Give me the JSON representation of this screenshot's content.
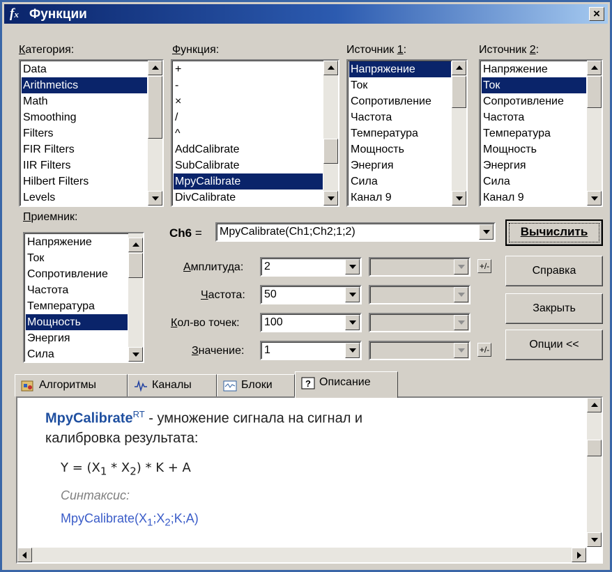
{
  "window": {
    "title": "Функции",
    "close": "×"
  },
  "category": {
    "label_u": "К",
    "label_rest": "атегория:",
    "items": [
      {
        "text": "Data"
      },
      {
        "text": "Arithmetics",
        "selected": true
      },
      {
        "text": "Math"
      },
      {
        "text": "Smoothing"
      },
      {
        "text": "Filters"
      },
      {
        "text": "FIR Filters"
      },
      {
        "text": "IIR Filters"
      },
      {
        "text": "Hilbert Filters"
      },
      {
        "text": "Levels"
      }
    ]
  },
  "function": {
    "label_u": "Ф",
    "label_rest": "ункция:",
    "items": [
      {
        "text": "+"
      },
      {
        "text": "-"
      },
      {
        "text": "×"
      },
      {
        "text": "/"
      },
      {
        "text": "^"
      },
      {
        "text": "AddCalibrate"
      },
      {
        "text": "SubCalibrate"
      },
      {
        "text": "MpyCalibrate",
        "selected": true
      },
      {
        "text": "DivCalibrate"
      }
    ]
  },
  "source1": {
    "label_pre": "Источник ",
    "label_u": "1",
    "label_post": ":",
    "items": [
      {
        "text": "Напряжение",
        "selected": true
      },
      {
        "text": "Ток"
      },
      {
        "text": "Сопротивление"
      },
      {
        "text": "Частота"
      },
      {
        "text": "Температура"
      },
      {
        "text": "Мощность"
      },
      {
        "text": "Энергия"
      },
      {
        "text": "Сила"
      },
      {
        "text": "Канал 9"
      }
    ]
  },
  "source2": {
    "label_pre": "Источник ",
    "label_u": "2",
    "label_post": ":",
    "items": [
      {
        "text": "Напряжение"
      },
      {
        "text": "Ток",
        "selected": true
      },
      {
        "text": "Сопротивление"
      },
      {
        "text": "Частота"
      },
      {
        "text": "Температура"
      },
      {
        "text": "Мощность"
      },
      {
        "text": "Энергия"
      },
      {
        "text": "Сила"
      },
      {
        "text": "Канал 9"
      }
    ]
  },
  "receiver": {
    "label_u": "П",
    "label_rest": "риемник:",
    "items": [
      {
        "text": "Напряжение"
      },
      {
        "text": "Ток"
      },
      {
        "text": "Сопротивление"
      },
      {
        "text": "Частота"
      },
      {
        "text": "Температура"
      },
      {
        "text": "Мощность",
        "selected": true
      },
      {
        "text": "Энергия"
      },
      {
        "text": "Сила"
      }
    ]
  },
  "formula": {
    "channel": "Ch6",
    "eq": "=",
    "value": "MpyCalibrate(Ch1;Ch2;1;2)"
  },
  "params": {
    "amplitude": {
      "label_u": "А",
      "label_rest": "мплитуда:",
      "value": "2"
    },
    "frequency": {
      "label_u": "Ч",
      "label_rest": "астота:",
      "value": "50"
    },
    "points": {
      "label_u": "К",
      "label_rest": "ол-во точек:",
      "value": "100"
    },
    "value": {
      "label_u": "З",
      "label_rest": "начение:",
      "value": "1"
    }
  },
  "buttons": {
    "compute": "Вычислить",
    "help": "Справка",
    "close": "Закрыть",
    "options": "Опции <<"
  },
  "tabs": {
    "algorithms": "Алгоритмы",
    "channels": "Каналы",
    "blocks": "Блоки",
    "description": "Описание"
  },
  "description": {
    "name": "MpyCalibrate",
    "sup": "RT",
    "text1": " - умножение сигнала на сигнал и",
    "text2": "калибровка результата:",
    "f_a": "Y = (X",
    "f_s1": "1",
    "f_b": " * X",
    "f_s2": "2",
    "f_c": ") * K + A",
    "syntax_label": "Синтаксис:",
    "s_a": "MpyCalibrate(X",
    "s_s1": "1",
    "s_b": ";X",
    "s_s2": "2",
    "s_c": ";K;A)"
  },
  "colors": {
    "selection": "#0a246a",
    "name": "#2050a0",
    "syntax": "#3a5cc8",
    "titlebar": "#0a246a"
  }
}
